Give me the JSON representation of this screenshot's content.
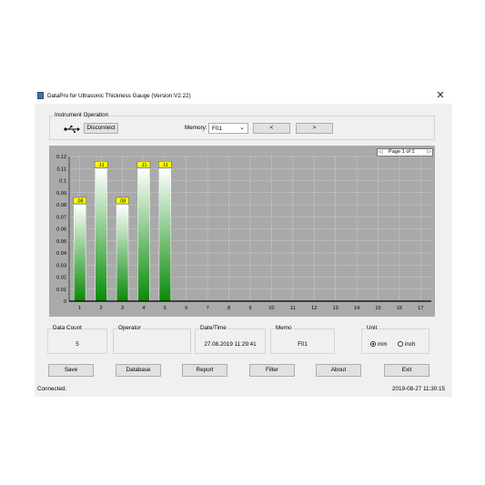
{
  "window": {
    "title": "DataPro for Ultrasonic Thickness Gauge (Version:V2.22)",
    "close_label": "✕"
  },
  "instrument_operation": {
    "legend": "Instrument Operation",
    "disconnect_label": "Disconnect",
    "memory_label": "Memory:",
    "memory_value": "F01",
    "prev_label": "<",
    "next_label": ">"
  },
  "pager": {
    "prev_label": "◁",
    "text": "Page 1 of 1",
    "next_label": "▷"
  },
  "chart_data": {
    "type": "bar",
    "categories": [
      "1",
      "2",
      "3",
      "4",
      "5",
      "6",
      "7",
      "8",
      "9",
      "10",
      "11",
      "12",
      "13",
      "14",
      "15",
      "16",
      "17"
    ],
    "values": [
      0.08,
      0.11,
      0.08,
      0.11,
      0.11
    ],
    "data_labels": [
      ".08",
      ".11",
      ".08",
      ".11",
      ".11"
    ],
    "yticks": [
      "0.12",
      "0.11",
      "0.1",
      "0.09",
      "0.08",
      "0.07",
      "0.06",
      "0.05",
      "0.04",
      "0.03",
      "0.02",
      "0.01",
      "0"
    ],
    "ylim": [
      0,
      0.12
    ],
    "grid": true,
    "colors": {
      "bar_top": "#ffffff",
      "bar_bottom": "#0a8a0a",
      "label_bg": "#ffff00",
      "plot_bg": "#a9a9a9"
    }
  },
  "info": {
    "data_count": {
      "label": "Data Count",
      "value": "5"
    },
    "operator": {
      "label": "Operator",
      "value": ""
    },
    "datetime": {
      "label": "Date/Time",
      "value": "27.08.2019 11:29:41"
    },
    "memo": {
      "label": "Memo",
      "value": "F01"
    },
    "unit": {
      "label": "Unit",
      "options": [
        "mm",
        "inch"
      ],
      "selected": "mm"
    }
  },
  "buttons": {
    "save": "Save",
    "database": "Database",
    "report": "Report",
    "filter": "Filter",
    "about": "About",
    "exit": "Exit"
  },
  "status": {
    "left": "Connected.",
    "right": "2019-08-27 11:30:15"
  }
}
